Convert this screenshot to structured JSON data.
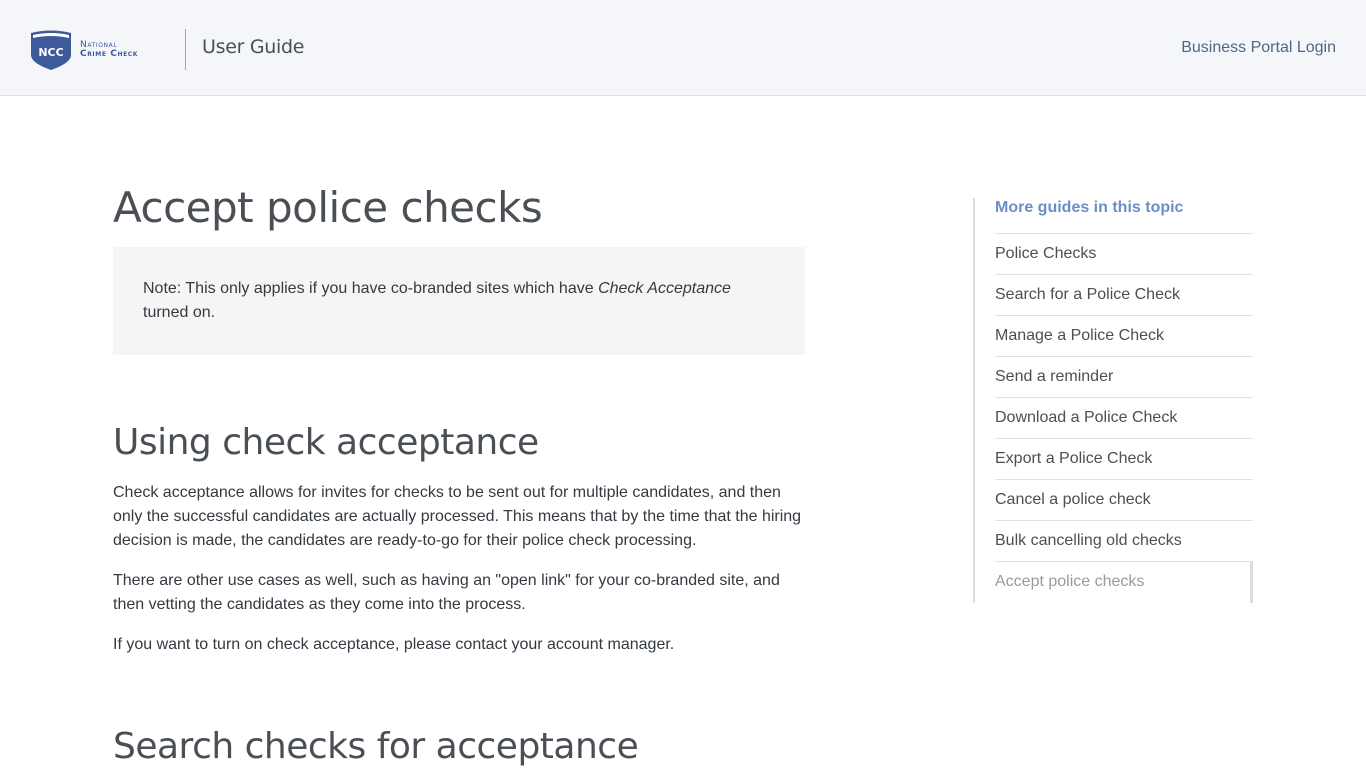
{
  "header": {
    "logo": {
      "abbr": "NCC",
      "line1": "National",
      "line2": "Crime Check",
      "color": "#3d5a9a"
    },
    "title": "User Guide",
    "login_link": "Business Portal Login"
  },
  "main": {
    "title": "Accept police checks",
    "note": {
      "prefix": "Note: This only applies if you have co-branded sites which have ",
      "emphasis": "Check Acceptance",
      "suffix": " turned on."
    },
    "sections": [
      {
        "heading": "Using check acceptance",
        "paragraphs": [
          "Check acceptance allows for invites for checks to be sent out for multiple candidates, and then only the successful candidates are actually processed. This means that by the time that the hiring decision is made, the candidates are ready-to-go for their police check processing.",
          "There are other use cases as well, such as having an \"open link\" for your co-branded site, and then vetting the candidates as they come into the process.",
          "If you want to turn on check acceptance, please contact your account manager."
        ]
      },
      {
        "heading": "Search checks for acceptance"
      }
    ]
  },
  "sidebar": {
    "heading": "More guides in this topic",
    "items": [
      {
        "label": "Police Checks"
      },
      {
        "label": "Search for a Police Check"
      },
      {
        "label": "Manage a Police Check"
      },
      {
        "label": "Send a reminder"
      },
      {
        "label": "Download a Police Check"
      },
      {
        "label": "Export a Police Check"
      },
      {
        "label": "Cancel a police check"
      },
      {
        "label": "Bulk cancelling old checks"
      },
      {
        "label": "Accept police checks",
        "active": true
      }
    ]
  }
}
